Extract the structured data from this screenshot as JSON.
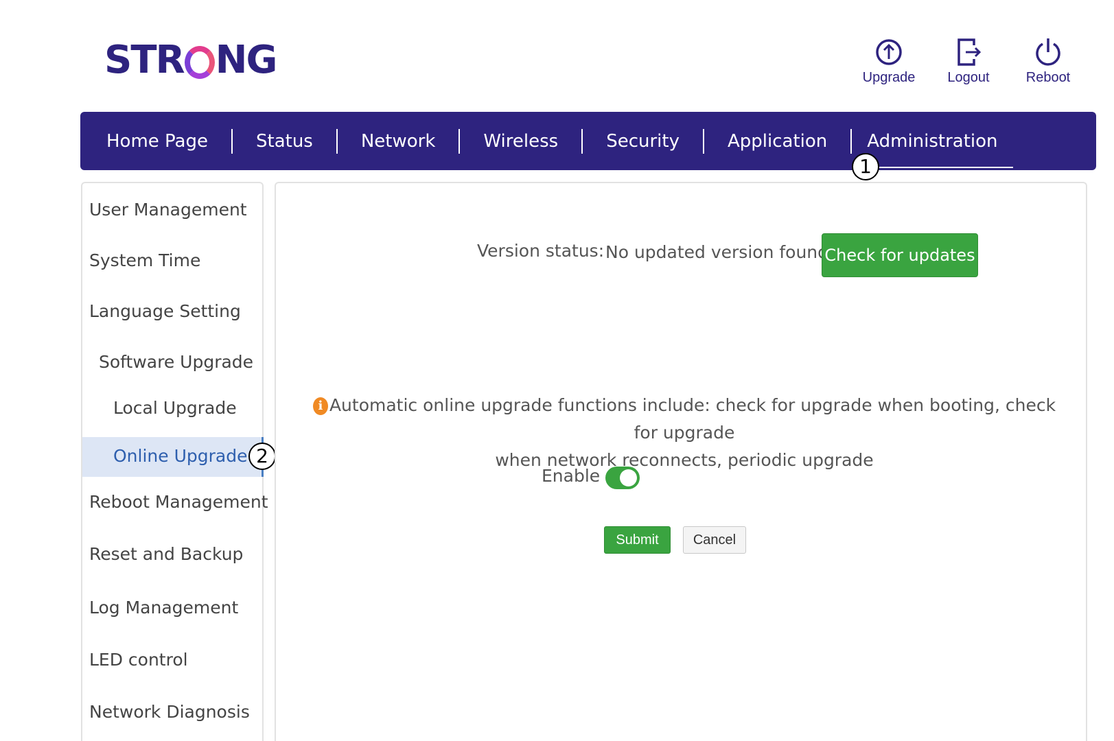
{
  "brand": {
    "logo_left": "STR",
    "logo_right": "NG",
    "logo_color": "#2e237f",
    "accent_gradient": [
      "#7b3fd6",
      "#e23c8d"
    ]
  },
  "top_actions": [
    {
      "label": "Upgrade",
      "icon": "upgrade-circle-arrow-icon"
    },
    {
      "label": "Logout",
      "icon": "logout-icon"
    },
    {
      "label": "Reboot",
      "icon": "power-icon"
    }
  ],
  "nav": {
    "items": [
      {
        "label": "Home Page"
      },
      {
        "label": "Status"
      },
      {
        "label": "Network"
      },
      {
        "label": "Wireless"
      },
      {
        "label": "Security"
      },
      {
        "label": "Application"
      },
      {
        "label": "Administration",
        "active": true
      }
    ],
    "bar_color": "#2e237f"
  },
  "callouts": [
    "1",
    "2"
  ],
  "sidebar": {
    "items": [
      {
        "label": "User Management"
      },
      {
        "label": "System Time"
      },
      {
        "label": "Language Setting"
      },
      {
        "label": "Software Upgrade"
      },
      {
        "label": "Local Upgrade"
      },
      {
        "label": "Online Upgrade",
        "active": true
      },
      {
        "label": "Reboot Management"
      },
      {
        "label": "Reset and Backup"
      },
      {
        "label": "Log Management"
      },
      {
        "label": "LED control"
      },
      {
        "label": "Network Diagnosis"
      }
    ]
  },
  "content": {
    "version_label": "Version status:",
    "version_value": "No updated version found",
    "check_button": "Check for updates",
    "notice_line1": "Automatic online upgrade functions include: check for upgrade when booting, check for upgrade",
    "notice_line2": "when network reconnects, periodic upgrade",
    "info_icon_glyph": "i",
    "enable_label": "Enable",
    "enable_on": true,
    "submit_button": "Submit",
    "cancel_button": "Cancel",
    "button_color": "#3aa440",
    "info_color": "#f08a24"
  }
}
